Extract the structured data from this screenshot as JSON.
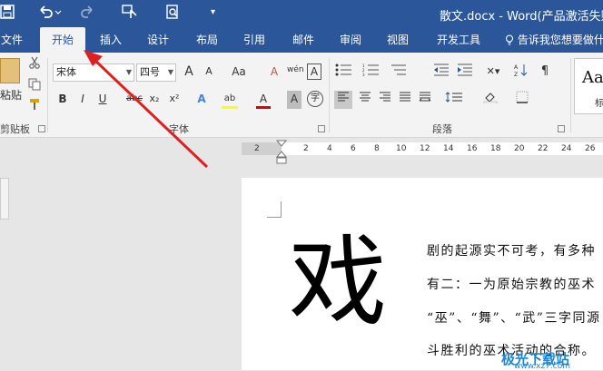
{
  "title_bar": {
    "document_title": "散文.docx - Word(产品激活失败)",
    "save_icon": "save-icon",
    "undo_icon": "undo-icon",
    "redo_icon": "redo-icon",
    "accent_color": "#2b579a"
  },
  "tabs": [
    {
      "label": "文件"
    },
    {
      "label": "开始"
    },
    {
      "label": "插入"
    },
    {
      "label": "设计"
    },
    {
      "label": "布局"
    },
    {
      "label": "引用"
    },
    {
      "label": "邮件"
    },
    {
      "label": "审阅"
    },
    {
      "label": "视图"
    },
    {
      "label": "开发工具"
    }
  ],
  "active_tab": "开始",
  "tell_me": "告诉我您想要做什么",
  "clipboard": {
    "paste_label": "粘贴",
    "group_label": "剪贴板"
  },
  "font": {
    "font_name": "宋体",
    "font_size": "四号",
    "group_label": "字体",
    "grow": "A",
    "shrink": "A",
    "case": "Aa",
    "clear": "A",
    "pinyin": "wén",
    "border_char": "A",
    "bold": "B",
    "italic": "I",
    "underline": "U",
    "strike": "abc",
    "subscript": "x₂",
    "superscript": "x²",
    "text_effect": "A",
    "highlight": "ab",
    "font_color": "A",
    "shading": "A",
    "enclose": "字"
  },
  "paragraph": {
    "group_label": "段落"
  },
  "styles": {
    "preview": "Aa",
    "sub": "标"
  },
  "ruler": {
    "numbers": [
      "2",
      "2",
      "4",
      "6",
      "8",
      "10",
      "12",
      "14",
      "16",
      "18",
      "20",
      "22",
      "24",
      "26"
    ]
  },
  "document": {
    "big_char": "戏",
    "lines": [
      "剧的起源实不可考，有多种",
      "有二：一为原始宗教的巫术",
      "“巫”、“舞”、“武”三字同源",
      "斗胜利的巫术活动的合称。"
    ]
  },
  "watermark": {
    "text": "极光下载站",
    "url": "www.xz7.com"
  }
}
